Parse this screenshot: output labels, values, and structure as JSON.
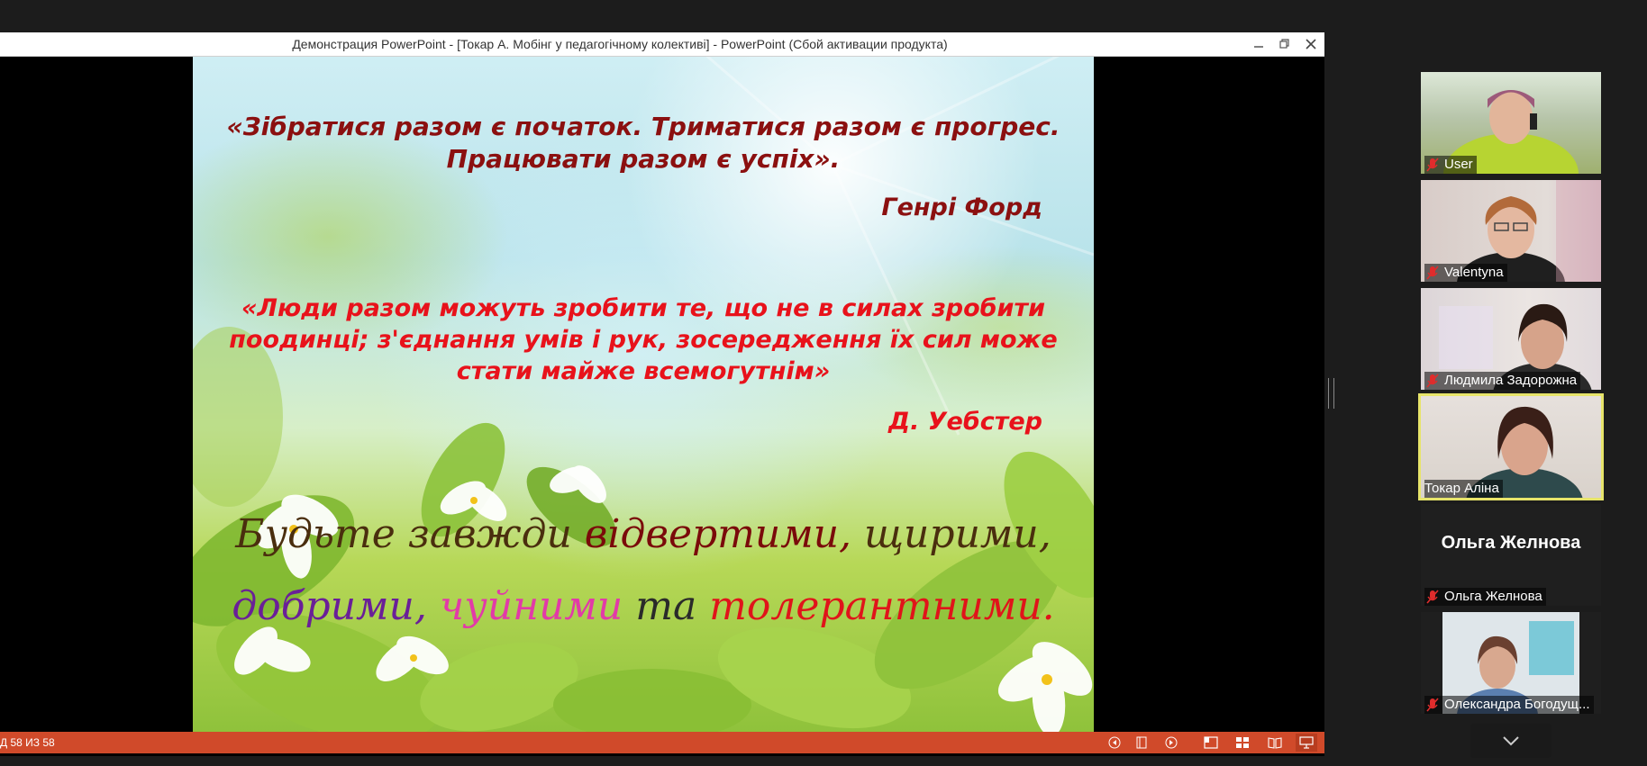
{
  "window": {
    "title": "Демонстрация PowerPoint - [Токар А. Мобінг у педагогічному колективі] - PowerPoint (Сбой активации продукта)"
  },
  "slide": {
    "quote1_line1": "«Зібратися разом є початок. Триматися разом є прогрес.",
    "quote1_line2": "Працювати разом є успіх».",
    "author1": "Генрі Форд",
    "quote2_line1": "«Люди разом можуть зробити те, що не в силах зробити",
    "quote2_line2": "поодинці; з'єднання умів і рук, зосередження їх сил може",
    "quote2_line3": "стати майже всемогутнім»",
    "author2": "Д. Уебстер",
    "motto": {
      "be": "Будьте завжди ",
      "open": "відвертими, ",
      "sincere": "щирими,",
      "kind": "добрими",
      "comma": ", ",
      "sensitive": "чуйними ",
      "and": " та ",
      "tolerant": "толерантними."
    }
  },
  "statusbar": {
    "counter": "Д 58 ИЗ 58"
  },
  "participants": [
    {
      "name": "User"
    },
    {
      "name": "Valentyna"
    },
    {
      "name": "Людмила Задорожна"
    },
    {
      "name": "Токар Аліна"
    },
    {
      "name": "Ольга Желнова",
      "label": "Ольга Желнова"
    },
    {
      "name": "Олександра Богодущ..."
    }
  ],
  "colors": {
    "statusbar": "#d04a2a",
    "active_speaker": "#e7e46a",
    "quote1": "#8b1010",
    "quote2": "#e8121b"
  },
  "icons": [
    "minimize-icon",
    "restore-icon",
    "close-icon",
    "prev-icon",
    "notes-icon",
    "next-icon",
    "normal-view-icon",
    "slide-sorter-icon",
    "reading-view-icon",
    "slideshow-icon",
    "mic-muted-icon",
    "chevron-down-icon"
  ]
}
